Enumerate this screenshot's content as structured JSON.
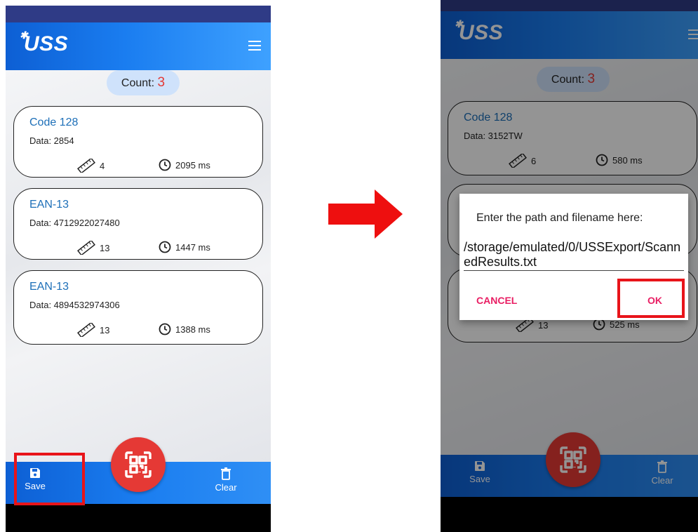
{
  "left_screen": {
    "logo": "USS",
    "count_label": "Count:",
    "count_value": "3",
    "results": [
      {
        "type": "Code 128",
        "data": "Data: 2854",
        "length": "4",
        "time": "2095 ms"
      },
      {
        "type": "EAN-13",
        "data": "Data: 4712922027480",
        "length": "13",
        "time": "1447 ms"
      },
      {
        "type": "EAN-13",
        "data": "Data: 4894532974306",
        "length": "13",
        "time": "1388 ms"
      }
    ],
    "save_label": "Save",
    "clear_label": "Clear"
  },
  "right_screen": {
    "logo": "USS",
    "count_label": "Count:",
    "count_value": "3",
    "results": [
      {
        "type": "Code 128",
        "data": "Data: 3152TW",
        "length": "6",
        "time": "580 ms"
      },
      {
        "length": "13",
        "time": "525 ms"
      }
    ],
    "save_label": "Save",
    "clear_label": "Clear",
    "dialog": {
      "prompt": "Enter the path and filename here:",
      "path_value": "/storage/emulated/0/USSExport/ScannedResults.txt",
      "cancel_label": "CANCEL",
      "ok_label": "OK"
    }
  },
  "colors": {
    "appbar": "#1a7df0",
    "accent_red": "#e53935",
    "highlight": "#e8141a",
    "card_type": "#1d6fb8",
    "dialog_button": "#e91e63"
  },
  "icons": [
    "menu-icon",
    "ruler-icon",
    "clock-icon",
    "save-icon",
    "trash-icon",
    "qr-scan-icon",
    "arrow-right-icon"
  ]
}
